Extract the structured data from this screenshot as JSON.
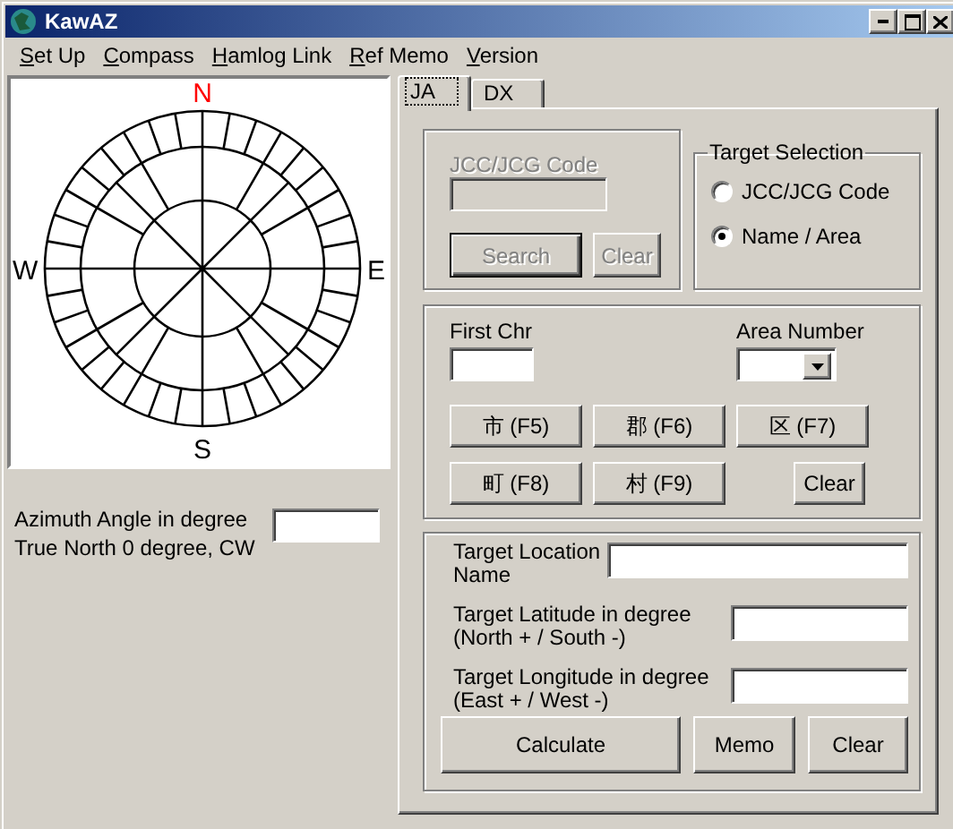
{
  "window": {
    "title": "KawAZ"
  },
  "menu": [
    "Set Up",
    "Compass",
    "Hamlog Link",
    "Ref Memo",
    "Version"
  ],
  "compass": {
    "directions": [
      {
        "kind": "north",
        "label": "N",
        "color": "#ff0000"
      },
      {
        "kind": "east",
        "label": "E",
        "color": "#000000"
      },
      {
        "kind": "south",
        "label": "S",
        "color": "#000000"
      },
      {
        "kind": "west",
        "label": "W",
        "color": "#000000"
      }
    ]
  },
  "azimuth": {
    "label": "Azimuth Angle in degree\nTrue North 0 degree, CW"
  },
  "tabs": [
    {
      "label": "JA",
      "selected": true
    },
    {
      "label": "DX",
      "selected": false
    }
  ],
  "jcc_search": {
    "label": "JCC/JCG Code",
    "disabled": true,
    "buttons": [
      {
        "label": "Search",
        "disabled": true,
        "default": true
      },
      {
        "label": "Clear",
        "disabled": true,
        "default": false
      }
    ]
  },
  "target_selection": {
    "title": "Target Selection",
    "options": [
      {
        "label": "JCC/JCG Code",
        "selected": false
      },
      {
        "label": "Name / Area",
        "selected": true
      }
    ]
  },
  "name_area": {
    "first_chr_label": "First Chr",
    "area_number_label": "Area Number",
    "area_buttons": [
      "市 (F5)",
      "郡 (F6)",
      "区 (F7)",
      "町 (F8)",
      "村 (F9)"
    ],
    "clear_button": "Clear"
  },
  "target": {
    "fields": [
      {
        "label": "Target Location\nName",
        "kind": "wide"
      },
      {
        "label": "Target Latitude in degree\n(North + / South -)",
        "kind": "narrow"
      },
      {
        "label": "Target Longitude in degree\n(East + / West -)",
        "kind": "narrow"
      }
    ],
    "buttons": [
      "Calculate",
      "Memo",
      "Clear"
    ]
  }
}
